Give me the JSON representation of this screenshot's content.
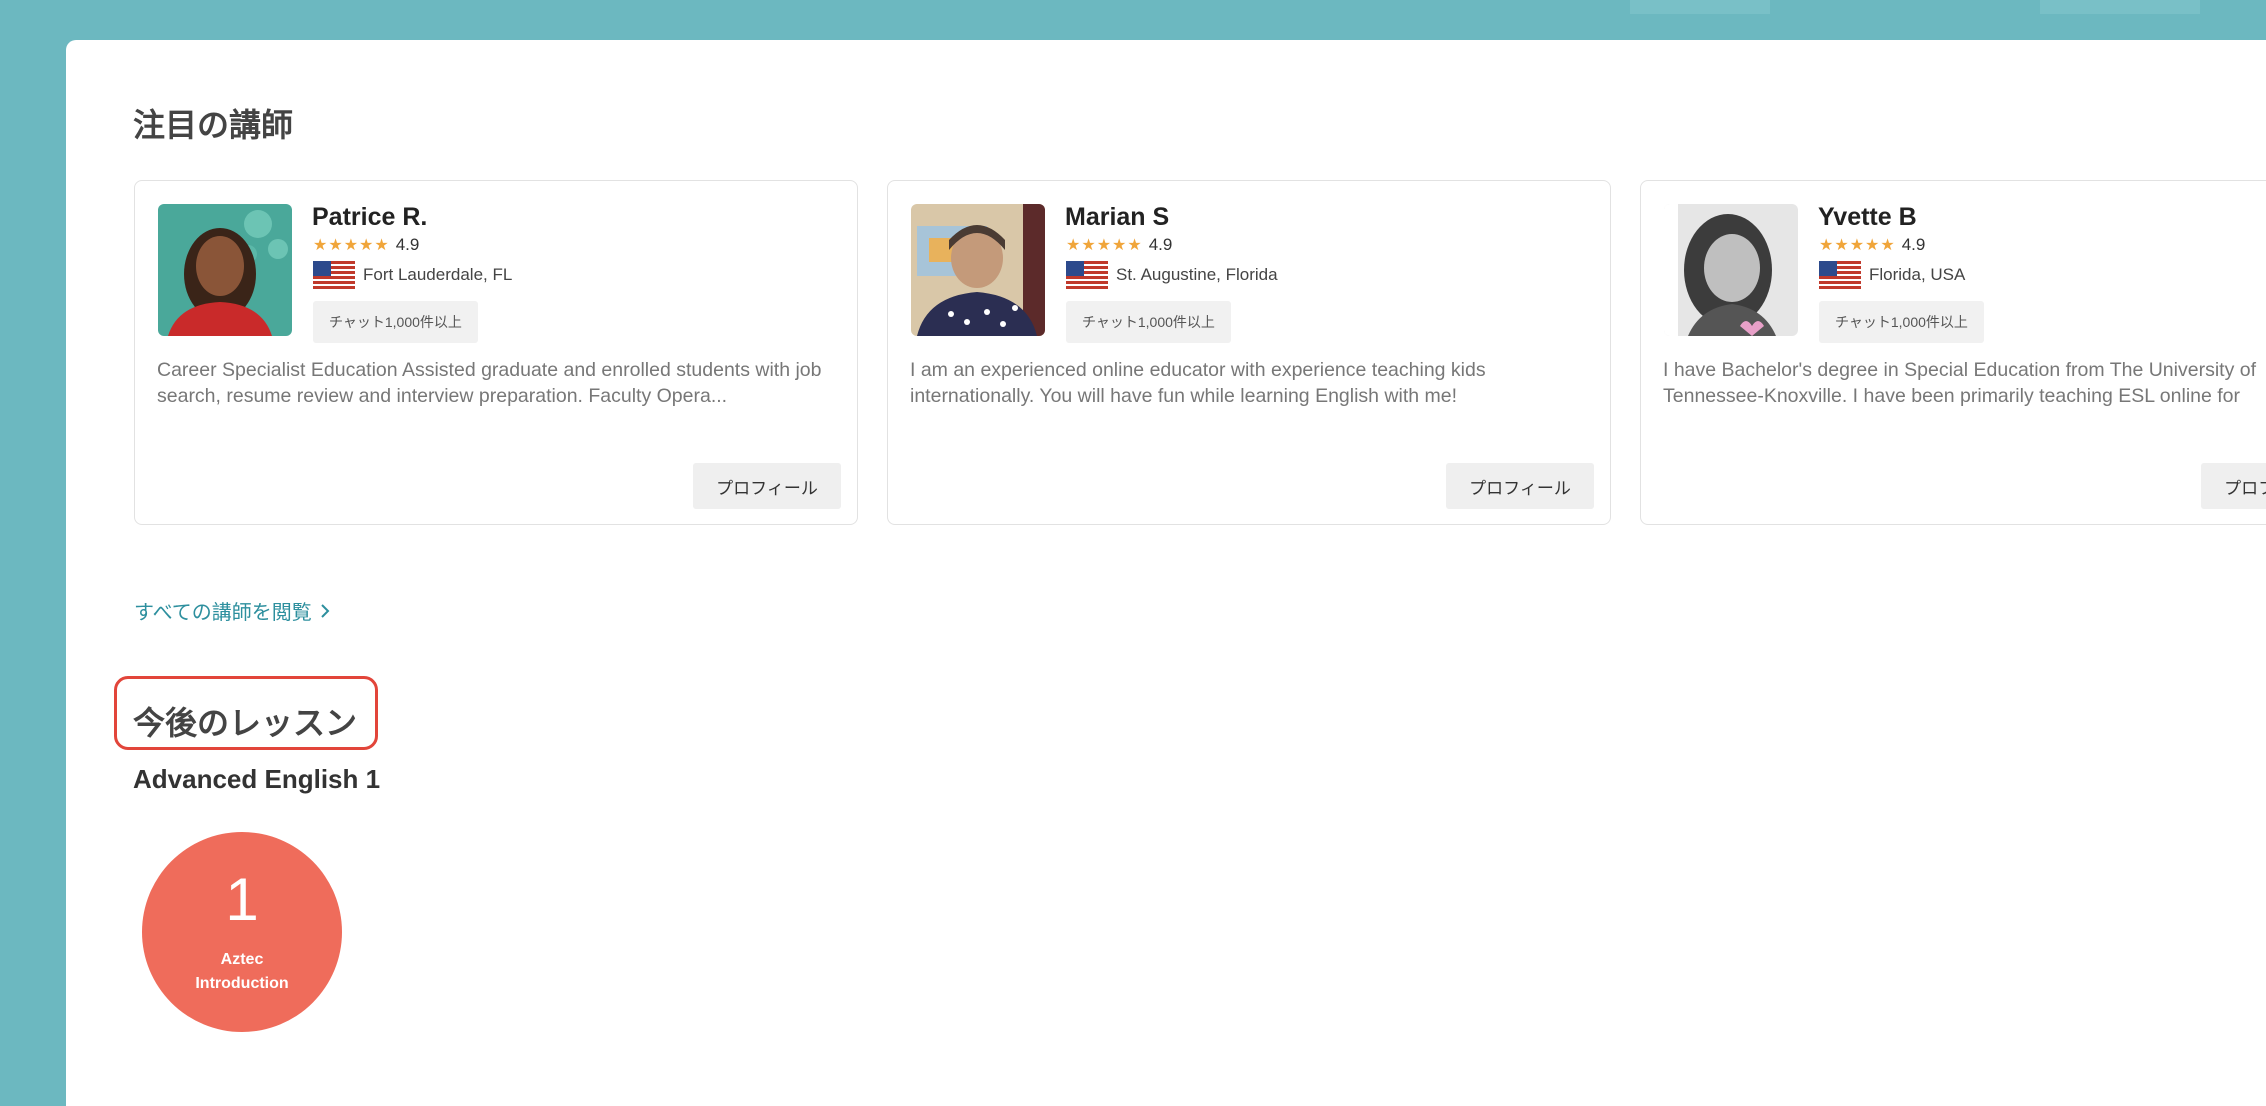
{
  "featured": {
    "title": "注目の講師",
    "view_all": "すべての講師を閲覧",
    "view_all_icon": "chevron-right-icon",
    "star_color": "#f0a53a",
    "teachers": [
      {
        "name": "Patrice R.",
        "rating": "4.9",
        "stars": "★★★★★",
        "location": "Fort Lauderdale, FL",
        "badge": "チャット1,000件以上",
        "description": "Career Specialist Education Assisted graduate and enrolled students with job search, resume review and interview preparation. Faculty Opera...",
        "profile_label": "プロフィール"
      },
      {
        "name": "Marian S",
        "rating": "4.9",
        "stars": "★★★★★",
        "location": "St. Augustine, Florida",
        "badge": "チャット1,000件以上",
        "description": "I am an experienced online educator with experience teaching kids internationally. You will have fun while learning English with me!",
        "profile_label": "プロフィール"
      },
      {
        "name": "Yvette B",
        "rating": "4.9",
        "stars": "★★★★★",
        "location": "Florida, USA",
        "badge": "チャット1,000件以上",
        "description": "I have Bachelor's degree in Special Education from The University of Tennessee-Knoxville. I have been primarily teaching ESL online for",
        "profile_label": "プロフィール"
      }
    ]
  },
  "upcoming": {
    "title": "今後のレッスン",
    "course_name": "Advanced English 1",
    "lesson": {
      "number": "1",
      "label_line1": "Aztec",
      "label_line2": "Introduction",
      "color": "#ef6c5b"
    }
  },
  "colors": {
    "background": "#6cb8c0",
    "link": "#2d8f9e",
    "highlight": "#e2453a"
  }
}
